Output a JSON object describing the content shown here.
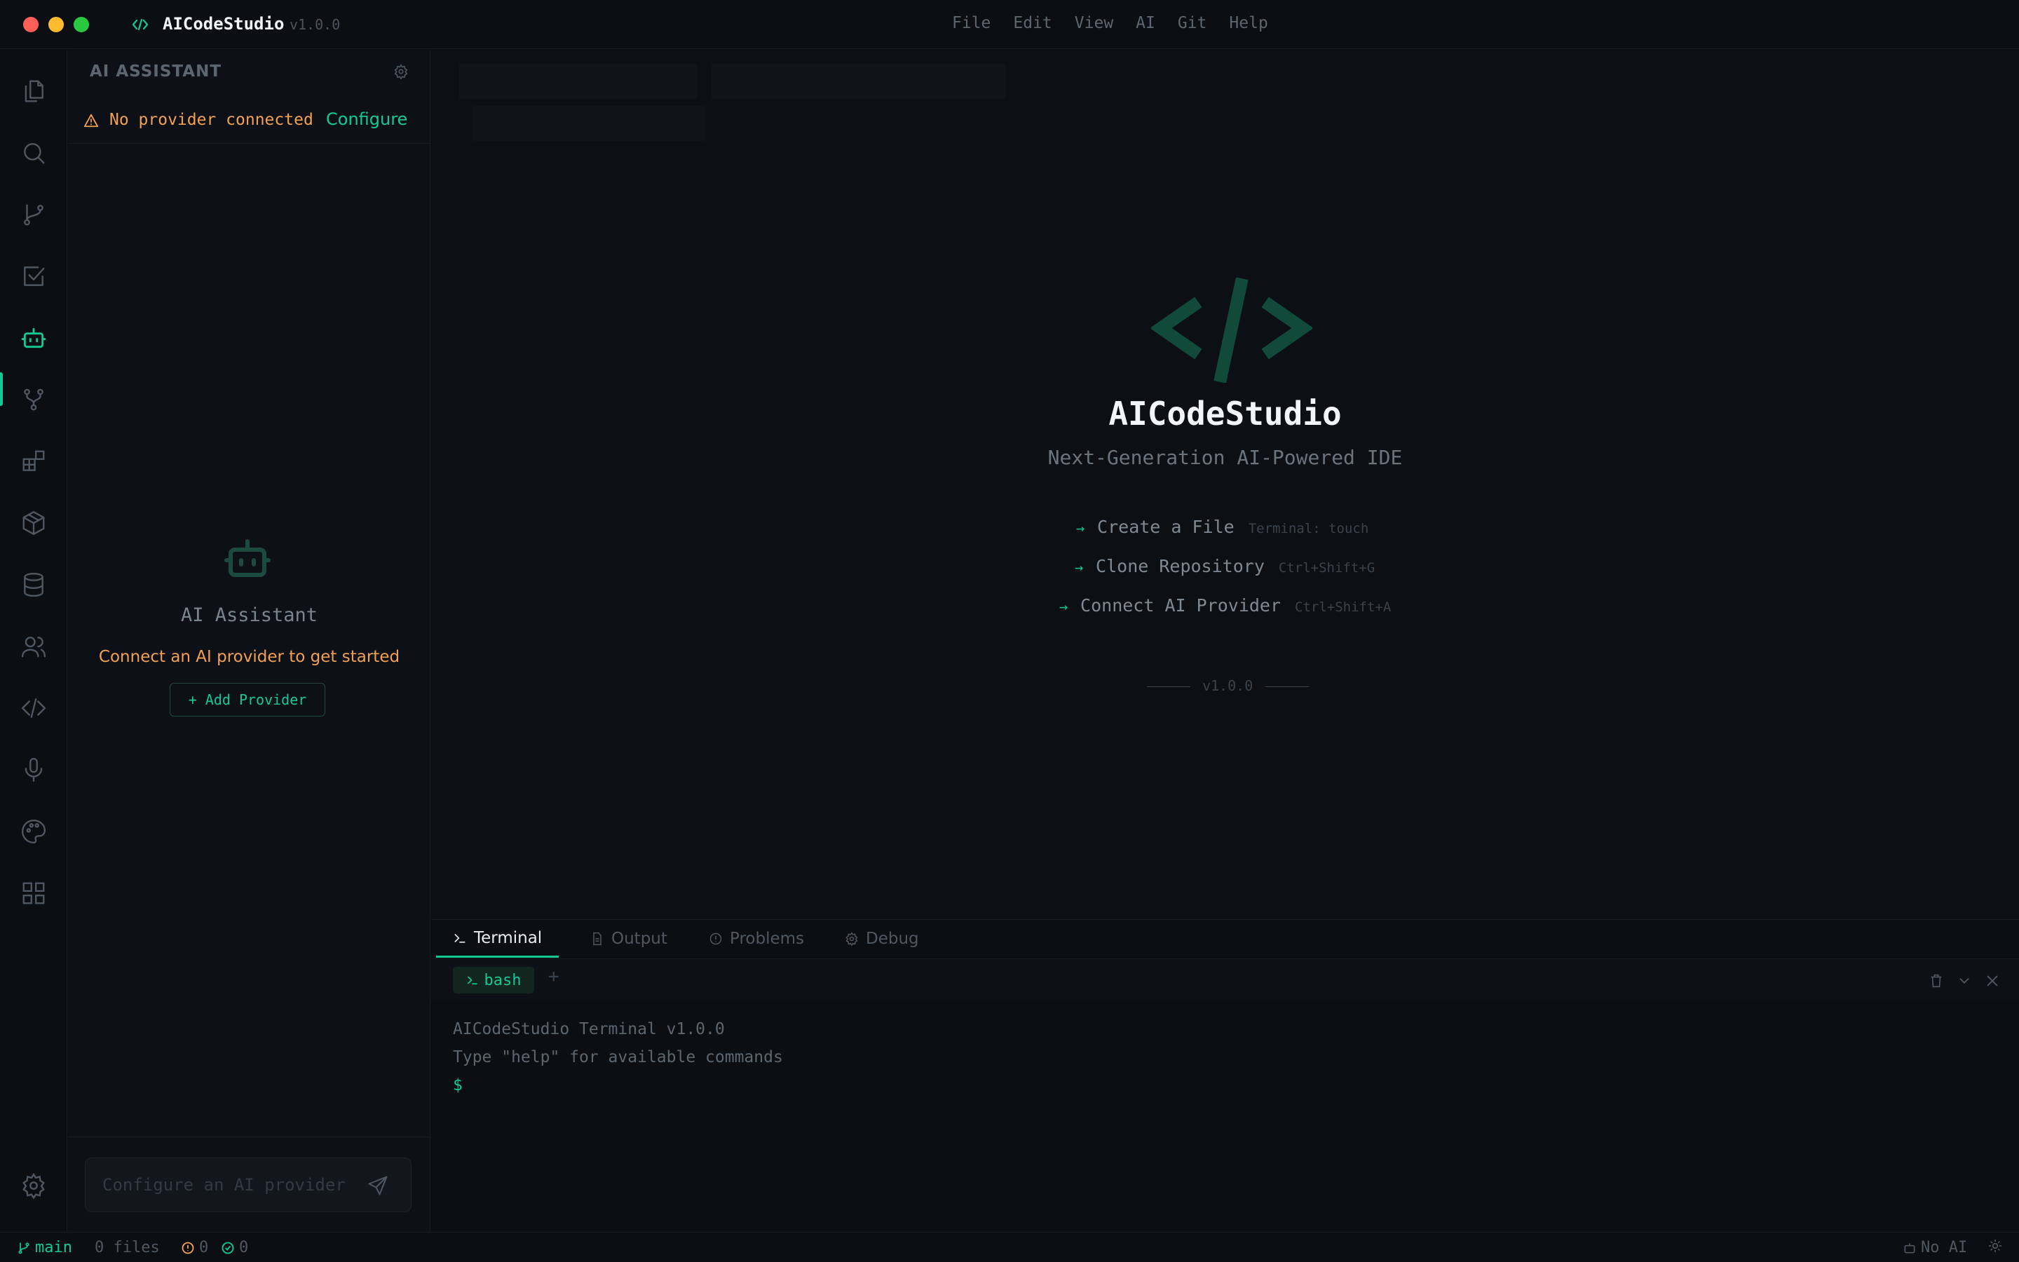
{
  "titlebar": {
    "app_name": "AICodeStudio",
    "version": "v1.0.0",
    "menu": [
      "File",
      "Edit",
      "View",
      "AI",
      "Git",
      "Help"
    ]
  },
  "activitybar": {
    "items": [
      "explorer-icon",
      "search-icon",
      "source-control-icon",
      "tasks-icon",
      "ai-assistant-icon",
      "git-branch-icon",
      "extensions-icon",
      "packages-icon",
      "database-icon",
      "users-icon",
      "code-icon",
      "microphone-icon",
      "palette-icon",
      "grid-icon",
      "settings-icon"
    ],
    "active": "ai-assistant-icon"
  },
  "sidebar": {
    "title": "AI ASSISTANT",
    "warning_text": "No provider connected",
    "configure_label": "Configure",
    "empty_title": "AI Assistant",
    "empty_subtitle": "Connect an AI provider to get started",
    "add_provider_label": "+ Add Provider",
    "chat_placeholder": "Configure an AI provider"
  },
  "editor": {
    "welcome_title": "AICodeStudio",
    "welcome_subtitle": "Next-Generation AI-Powered IDE",
    "actions": [
      {
        "label": "Create a File",
        "hint": "Terminal: touch"
      },
      {
        "label": "Clone Repository",
        "hint": "Ctrl+Shift+G"
      },
      {
        "label": "Connect AI Provider",
        "hint": "Ctrl+Shift+A"
      }
    ],
    "footer_version": "v1.0.0"
  },
  "panel": {
    "tabs": [
      "Terminal",
      "Output",
      "Problems",
      "Debug"
    ],
    "active_tab": "Terminal",
    "terminal_tab": "bash",
    "lines": [
      "AICodeStudio Terminal v1.0.0",
      "Type \"help\" for available commands"
    ],
    "prompt": "$"
  },
  "statusbar": {
    "branch": "main",
    "files": "0 files",
    "errors": "0",
    "checks": "0",
    "ai_status": "No AI"
  },
  "colors": {
    "accent": "#14c896",
    "warning": "#f0a050",
    "background": "#0b0e13"
  }
}
